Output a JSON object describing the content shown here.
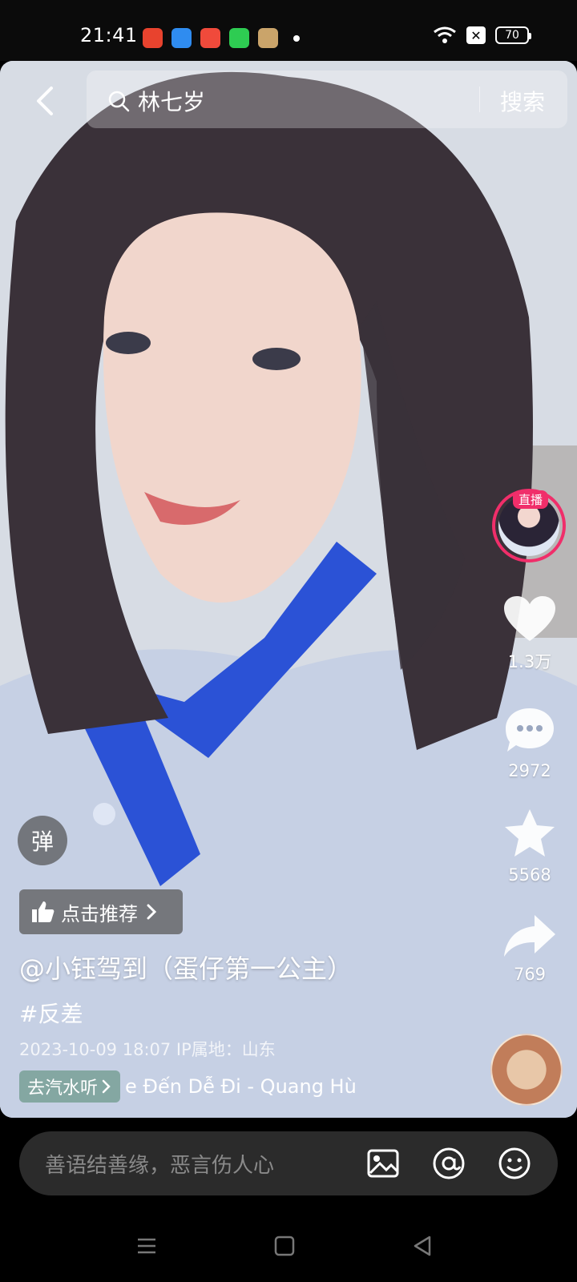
{
  "status_bar": {
    "time": "21:41",
    "battery": "70",
    "app_icon_colors": [
      "#e8432e",
      "#2f8cf0",
      "#f04a3b",
      "#2ecc52",
      "#caa46a"
    ]
  },
  "search": {
    "query": "林七岁",
    "button_label": "搜索"
  },
  "live": {
    "badge": "直播",
    "accent_color": "#f02e6a"
  },
  "actions": {
    "likes": "1.3万",
    "comments": "2972",
    "favorites": "5568",
    "shares": "769"
  },
  "overlay": {
    "danmu_label": "弹",
    "recommend_label": "点击推荐",
    "author": "@小钰驾到（蛋仔第一公主）",
    "hashtag": "#反差",
    "meta": "2023-10-09 18:07  IP属地：山东",
    "music_chip": "去汽水听",
    "music_title": "e Đến Dễ Đi - Quang Hùn"
  },
  "comment_bar": {
    "placeholder": "善语结善缘，恶言伤人心",
    "icons": [
      "image-icon",
      "at-icon",
      "emoji-icon"
    ]
  },
  "nav": {
    "icons": [
      "menu-icon",
      "home-icon",
      "back-triangle-icon"
    ]
  }
}
